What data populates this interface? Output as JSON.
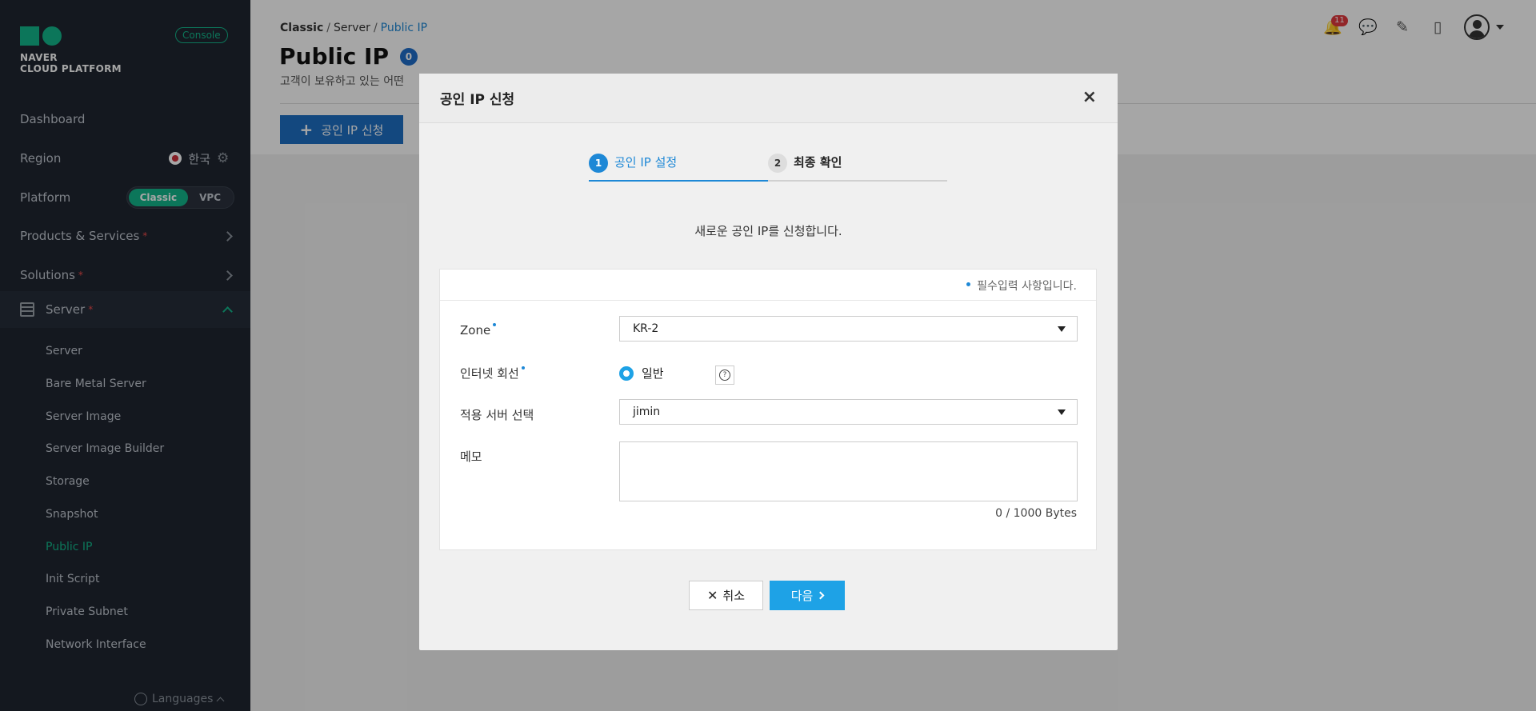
{
  "sidebar": {
    "brand_line1": "NAVER",
    "brand_line2": "CLOUD PLATFORM",
    "console_badge": "Console",
    "dashboard": "Dashboard",
    "region_label": "Region",
    "region_value": "한국",
    "platform_label": "Platform",
    "platform_options": [
      "Classic",
      "VPC"
    ],
    "products_services": "Products & Services",
    "solutions": "Solutions",
    "server_section": "Server",
    "server_items": [
      "Server",
      "Bare Metal Server",
      "Server Image",
      "Server Image Builder",
      "Storage",
      "Snapshot",
      "Public IP",
      "Init Script",
      "Private Subnet",
      "Network Interface"
    ],
    "languages": "Languages",
    "asterisk": "*"
  },
  "header": {
    "breadcrumb": [
      "Classic",
      "Server",
      "Public IP"
    ],
    "breadcrumb_sep": "/",
    "page_title": "Public IP",
    "count": "0",
    "subtitle": "고객이 보유하고 있는 어떤",
    "apply_button": "공인 IP 신청",
    "plus": "+",
    "notifications": "11"
  },
  "modal": {
    "title": "공인 IP 신청",
    "close": "×",
    "steps": [
      {
        "num": "1",
        "label": "공인 IP 설정"
      },
      {
        "num": "2",
        "label": "최종 확인"
      }
    ],
    "intro": "새로운 공인 IP를 신청합니다.",
    "required_note": "필수입력 사항입니다.",
    "fields": {
      "zone_label": "Zone",
      "zone_value": "KR-2",
      "internet_label": "인터넷 회선",
      "internet_value": "일반",
      "server_label": "적용 서버 선택",
      "server_value": "jimin",
      "memo_label": "메모",
      "byte_count": "0 / 1000 Bytes",
      "help": "?"
    },
    "cancel_button": "취소",
    "next_button": "다음",
    "cancel_icon": "✕"
  },
  "colors": {
    "accent": "#1e88d6",
    "brand_green": "#13b58a",
    "sidebar_bg": "#1f2530",
    "primary_button": "#1ea2e6"
  }
}
